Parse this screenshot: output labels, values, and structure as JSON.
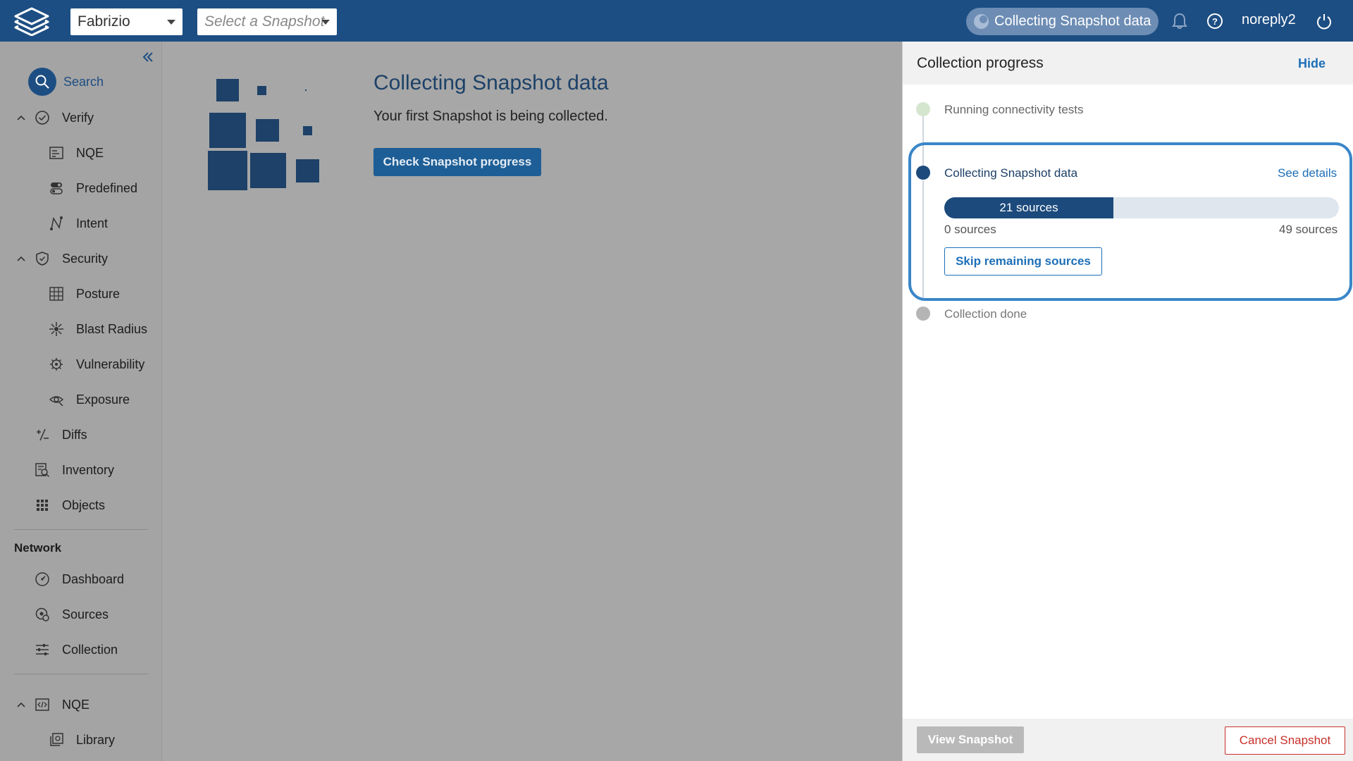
{
  "header": {
    "workspace": "Fabrizio",
    "snapshot_placeholder": "Select a Snapshot",
    "status": "Collecting Snapshot data",
    "username": "noreply2"
  },
  "sidebar": {
    "search": "Search",
    "verify": {
      "label": "Verify",
      "items": [
        {
          "label": "NQE",
          "icon": "nqe-icon"
        },
        {
          "label": "Predefined",
          "icon": "toggle-icon"
        },
        {
          "label": "Intent",
          "icon": "path-icon"
        }
      ]
    },
    "security": {
      "label": "Security",
      "items": [
        {
          "label": "Posture",
          "icon": "posture-grid-icon"
        },
        {
          "label": "Blast Radius",
          "icon": "blast-icon"
        },
        {
          "label": "Vulnerability",
          "icon": "virus-icon"
        },
        {
          "label": "Exposure",
          "icon": "eye-icon"
        }
      ]
    },
    "diffs": "Diffs",
    "inventory": "Inventory",
    "objects": "Objects",
    "network_title": "Network",
    "network": [
      {
        "label": "Dashboard",
        "icon": "gauge-icon"
      },
      {
        "label": "Sources",
        "icon": "sources-gear-icon"
      },
      {
        "label": "Collection",
        "icon": "sliders-icon"
      }
    ],
    "nqe": {
      "label": "NQE",
      "items": [
        {
          "label": "Library",
          "icon": "library-icon"
        }
      ]
    }
  },
  "main": {
    "title": "Collecting Snapshot data",
    "subtitle": "Your first Snapshot is being collected.",
    "check_button": "Check Snapshot progress"
  },
  "panel": {
    "title": "Collection progress",
    "hide": "Hide",
    "steps": [
      {
        "label": "Running connectivity tests",
        "state": "done"
      },
      {
        "label": "Collecting Snapshot data",
        "state": "active"
      },
      {
        "label": "Collection done",
        "state": "pending"
      }
    ],
    "see_details": "See details",
    "progress": {
      "current_label": "21 sources",
      "current": 21,
      "min_label": "0 sources",
      "max_label": "49 sources",
      "min": 0,
      "max": 49
    },
    "skip_button": "Skip remaining sources",
    "view_button": "View Snapshot",
    "cancel_button": "Cancel Snapshot"
  },
  "colors": {
    "brand": "#1d4e83",
    "accent_link": "#1d6fb8",
    "danger": "#c7302a"
  }
}
